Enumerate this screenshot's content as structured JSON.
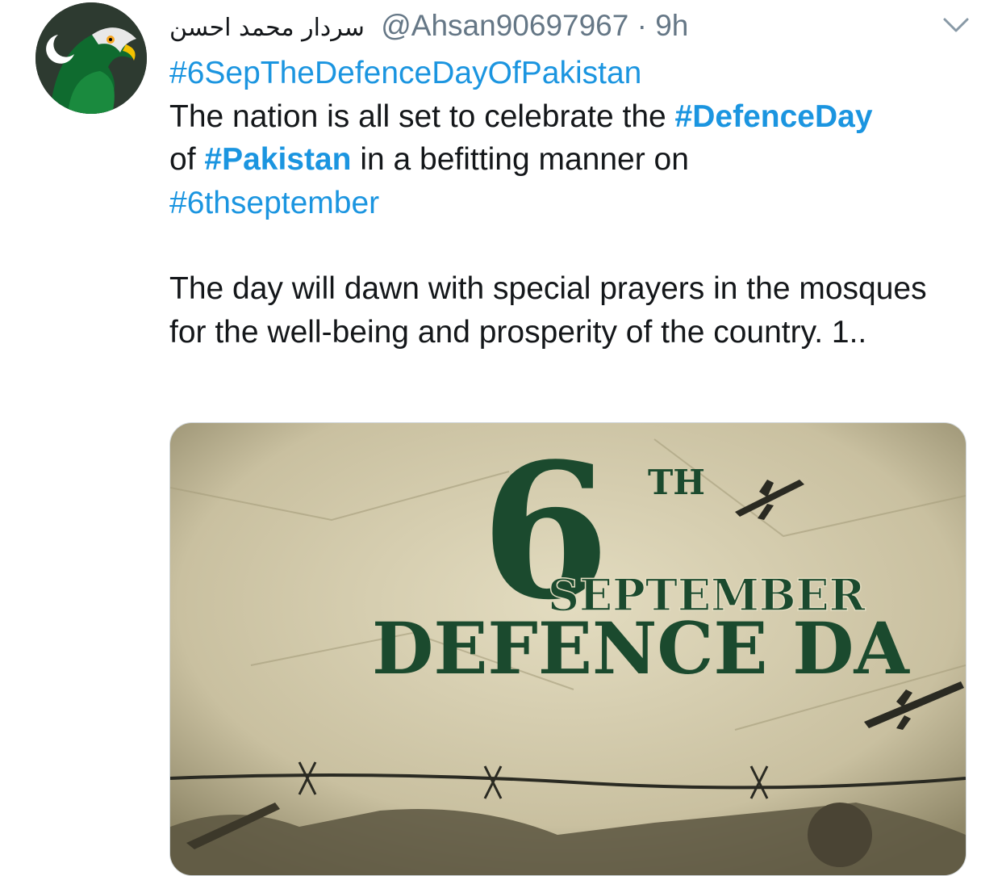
{
  "tweet": {
    "display_name": "سردار محمد احسن",
    "handle": "@Ahsan90697967",
    "separator": "·",
    "time": "9h",
    "line1_hashtag": "#6SepTheDefenceDayOfPakistan",
    "text_a": "The nation is all set to celebrate the ",
    "hashtag_defenceday": "#DefenceDay",
    "text_b": "of ",
    "hashtag_pakistan": "#Pakistan",
    "text_c": " in a befitting manner on",
    "hashtag_6thseptember": "#6thseptember",
    "paragraph2": "The day will dawn with special prayers in the mosques for the well-being and prosperity of the country. 1.."
  },
  "media": {
    "big_number": "6",
    "superscript": "TH",
    "month": "SEPTEMBER",
    "title": "DEFENCE DA"
  },
  "icons": {
    "menu": "chevron-down-icon",
    "avatar": "eagle-avatar"
  },
  "colors": {
    "link": "#1b95e0",
    "meta": "#657786",
    "poster_green": "#1b4a2e"
  }
}
